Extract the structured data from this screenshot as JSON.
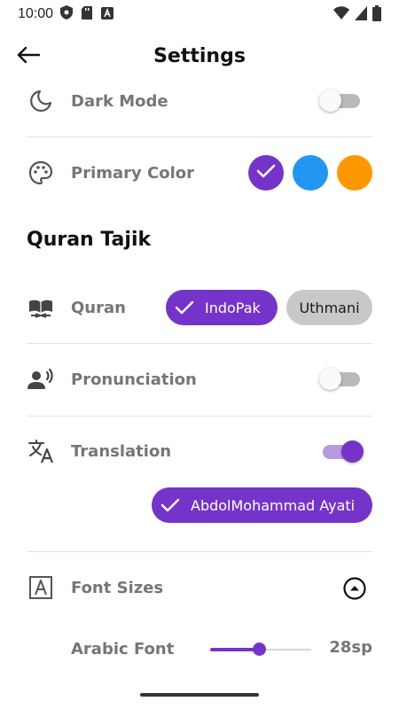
{
  "status_bar": {
    "time": "10:00"
  },
  "header": {
    "title": "Settings"
  },
  "appearance": {
    "dark_mode": {
      "label": "Dark Mode",
      "enabled": false
    },
    "primary_color": {
      "label": "Primary Color",
      "options": [
        "#7434c9",
        "#2196f3",
        "#ff9800"
      ],
      "selected": "#7434c9"
    }
  },
  "section": {
    "title": "Quran Tajik"
  },
  "quran": {
    "label": "Quran",
    "options": [
      {
        "label": "IndoPak",
        "selected": true
      },
      {
        "label": "Uthmani",
        "selected": false
      }
    ]
  },
  "pronunciation": {
    "label": "Pronunciation",
    "enabled": false
  },
  "translation": {
    "label": "Translation",
    "enabled": true,
    "selected_translation": "AbdolMohammad Ayati"
  },
  "font_sizes": {
    "label": "Font Sizes",
    "arabic_font": {
      "label": "Arabic Font",
      "value": "28sp",
      "slider_fraction": 0.49
    }
  },
  "colors": {
    "accent": "#7434c9",
    "label_gray": "#767676"
  }
}
